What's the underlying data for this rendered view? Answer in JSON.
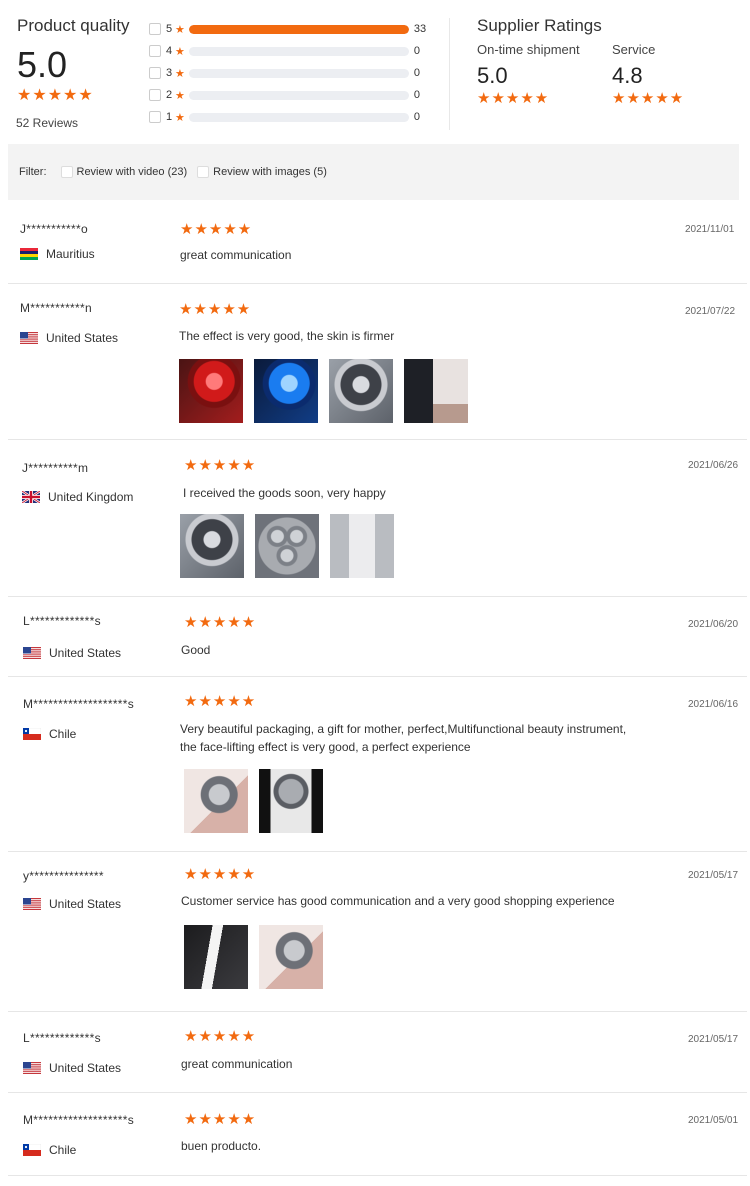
{
  "product_quality": {
    "title": "Product quality",
    "score": "5.0",
    "stars": "★★★★★",
    "review_count": "52 Reviews",
    "distribution": [
      {
        "rating": "5",
        "count": "33",
        "fraction": 1.0
      },
      {
        "rating": "4",
        "count": "0",
        "fraction": 0
      },
      {
        "rating": "3",
        "count": "0",
        "fraction": 0
      },
      {
        "rating": "2",
        "count": "0",
        "fraction": 0
      },
      {
        "rating": "1",
        "count": "0",
        "fraction": 0
      }
    ]
  },
  "supplier_ratings": {
    "title": "Supplier Ratings",
    "on_time": {
      "label": "On-time shipment",
      "value": "5.0",
      "stars": "★★★★★"
    },
    "service": {
      "label": "Service",
      "value": "4.8",
      "stars": "★★★★★"
    }
  },
  "filter": {
    "label": "Filter:",
    "video_label": "Review with video (23)",
    "images_label": "Review with images (5)"
  },
  "colors": {
    "accent": "#f26a10"
  },
  "reviews": [
    {
      "user": "J***********o",
      "country": "Mauritius",
      "flag": "mauritius-flag",
      "stars": "★★★★★",
      "date": "2021/11/01",
      "text": "great communication",
      "photos": []
    },
    {
      "user": "M***********n",
      "country": "United States",
      "flag": "us-flag",
      "stars": "★★★★★",
      "date": "2021/07/22",
      "text": "The effect is very good, the skin is firmer",
      "photos": [
        "red-light-device-photo",
        "blue-light-device-photo",
        "device-head-photo",
        "device-box-photo"
      ]
    },
    {
      "user": "J**********m",
      "country": "United Kingdom",
      "flag": "uk-flag",
      "stars": "★★★★★",
      "date": "2021/06/26",
      "text": "I received the goods soon, very happy",
      "photos": [
        "device-head-photo",
        "device-closeup-photo",
        "device-side-photo"
      ]
    },
    {
      "user": "L*************s",
      "country": "United States",
      "flag": "us-flag",
      "stars": "★★★★★",
      "date": "2021/06/20",
      "text": "Good",
      "photos": []
    },
    {
      "user": "M*******************s",
      "country": "Chile",
      "flag": "chile-flag",
      "stars": "★★★★★",
      "date": "2021/06/16",
      "text": "Very beautiful packaging, a gift for mother, perfect,Multifunctional beauty instrument, the face-lifting effect is very good, a perfect experience",
      "photos": [
        "device-in-hand-photo",
        "device-dark-photo"
      ]
    },
    {
      "user": "y***************",
      "country": "United States",
      "flag": "us-flag",
      "stars": "★★★★★",
      "date": "2021/05/17",
      "text": "Customer service has good communication and a very good shopping experience",
      "photos": [
        "device-charging-photo",
        "device-in-hand-photo"
      ]
    },
    {
      "user": "L*************s",
      "country": "United States",
      "flag": "us-flag",
      "stars": "★★★★★",
      "date": "2021/05/17",
      "text": "great communication",
      "photos": []
    },
    {
      "user": "M*******************s",
      "country": "Chile",
      "flag": "chile-flag",
      "stars": "★★★★★",
      "date": "2021/05/01",
      "text": "buen producto.",
      "photos": []
    }
  ]
}
